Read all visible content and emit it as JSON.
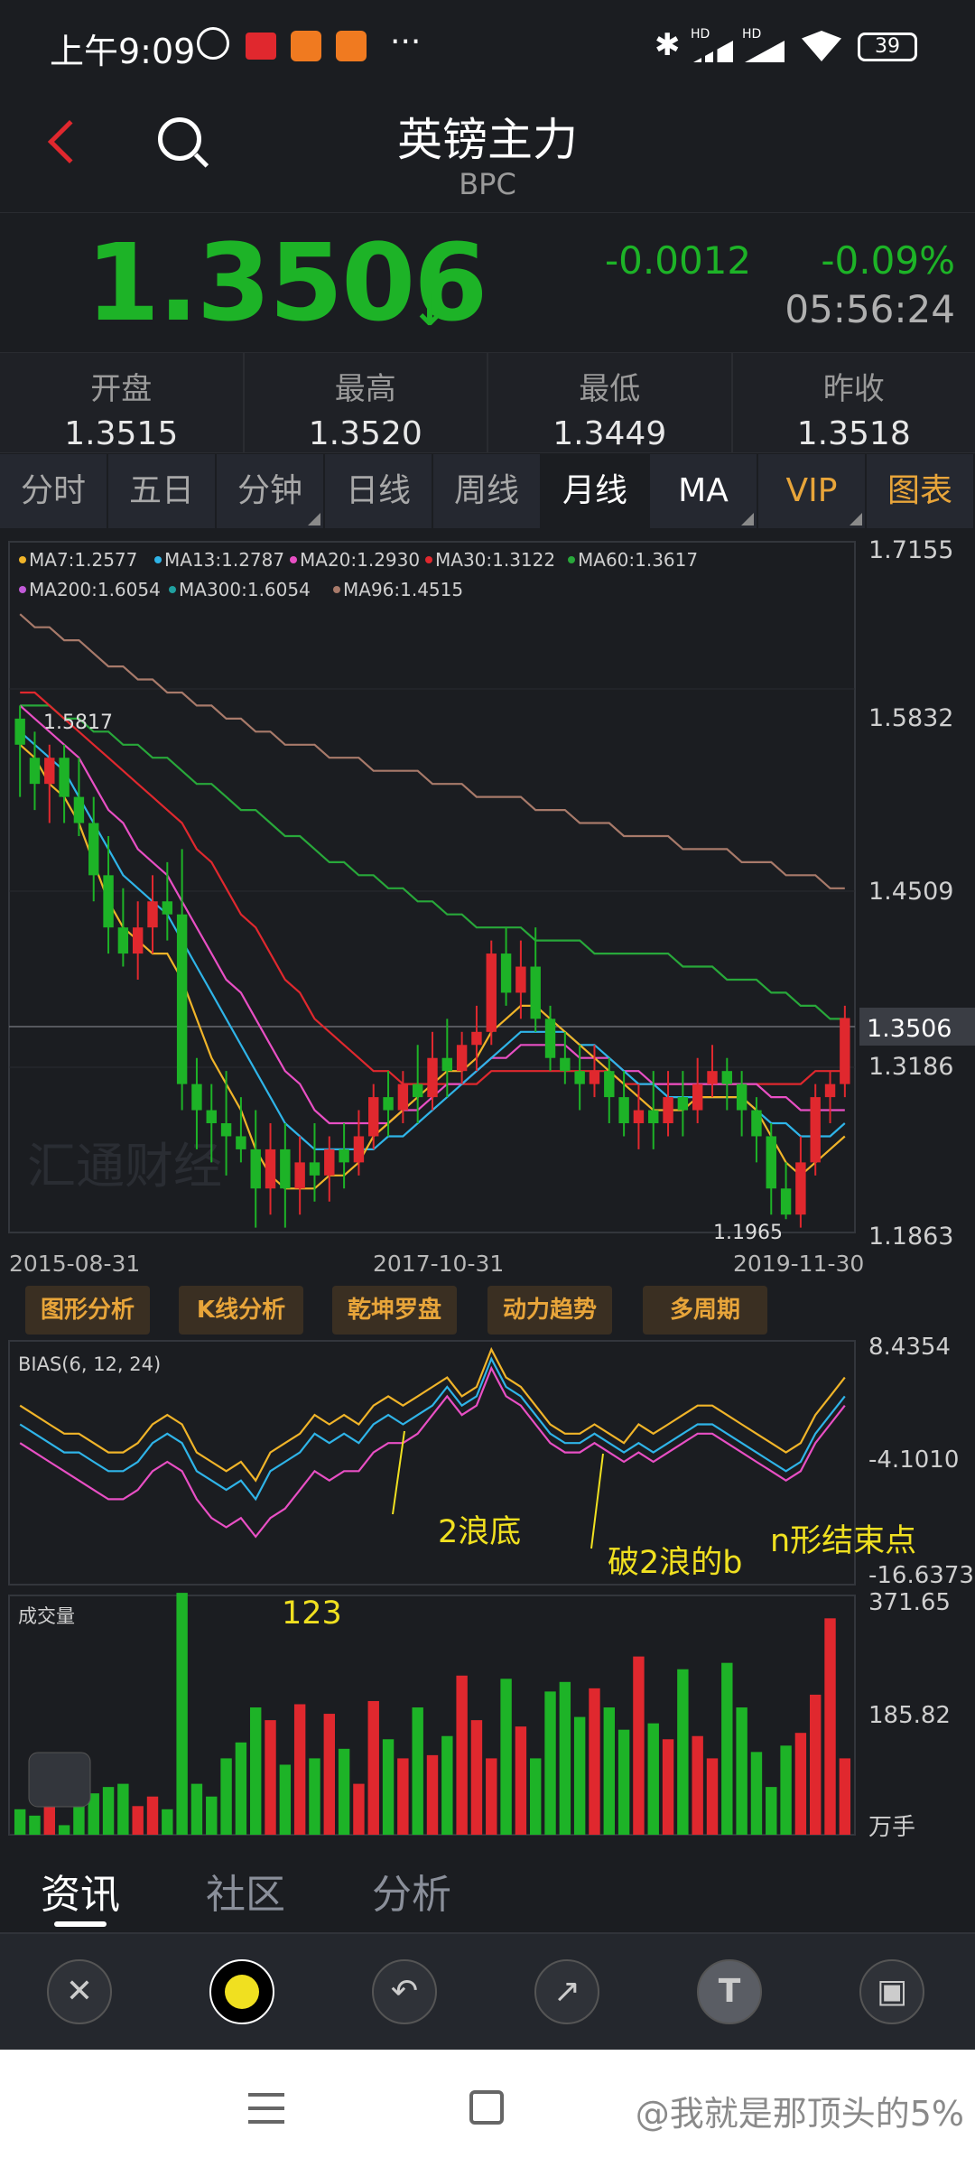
{
  "status": {
    "time": "上午9:09",
    "dots": "···",
    "battery": "39",
    "net1": "HD",
    "net2": "HD"
  },
  "header": {
    "title": "英镑主力",
    "code": "BPC"
  },
  "quote": {
    "price": "1.3506",
    "change": "-0.0012",
    "pct": "-0.09%",
    "time": "05:56:24",
    "colors": {
      "down": "#1db327",
      "up": "#e0282e"
    }
  },
  "ohlc": [
    {
      "label": "开盘",
      "value": "1.3515"
    },
    {
      "label": "最高",
      "value": "1.3520"
    },
    {
      "label": "最低",
      "value": "1.3449"
    },
    {
      "label": "昨收",
      "value": "1.3518"
    }
  ],
  "tabs": [
    "分时",
    "五日",
    "分钟",
    "日线",
    "周线",
    "月线",
    "MA",
    "VIP",
    "图表"
  ],
  "ma_legend": [
    {
      "text": "MA7:1.2577",
      "color": "#f0b429"
    },
    {
      "text": "MA13:1.2787",
      "color": "#2fb4e8"
    },
    {
      "text": "MA20:1.2930",
      "color": "#e84fc4"
    },
    {
      "text": "MA30:1.3122",
      "color": "#e0282e"
    },
    {
      "text": "MA60:1.3617",
      "color": "#28a83a"
    },
    {
      "text": "MA200:1.6054",
      "color": "#c15ad8"
    },
    {
      "text": "MA300:1.6054",
      "color": "#20a0a0"
    },
    {
      "text": "MA96:1.4515",
      "color": "#a87a6a"
    }
  ],
  "main_axis": [
    "1.7155",
    "1.5832",
    "1.4509",
    "1.3186",
    "1.1863"
  ],
  "current_price_tag": "1.3506",
  "high_label": "1.5817",
  "low_label": "1.1965",
  "dates": [
    "2015-08-31",
    "2017-10-31",
    "2019-11-30"
  ],
  "watermark": "汇通财经",
  "func_buttons": [
    "图形分析",
    "K线分析",
    "乾坤罗盘",
    "动力趋势",
    "多周期"
  ],
  "bias": {
    "label": "BIAS(6, 12, 24)",
    "axis": [
      "8.4354",
      "-4.1010",
      "-16.6373"
    ],
    "notes": [
      "2浪底",
      "破2浪的b",
      "n形结束点"
    ]
  },
  "volume": {
    "label": "成交量",
    "axis": [
      "371.65",
      "185.82",
      "万手"
    ],
    "note": "123"
  },
  "bottom_tabs": [
    "资讯",
    "社区",
    "分析"
  ],
  "tool_icons": [
    "close-icon",
    "color-dot-icon",
    "undo-icon",
    "arrow-icon",
    "text-icon",
    "save-icon"
  ],
  "tool_glyphs": {
    "t": "T"
  },
  "sysnav_watermark": "@我就是那顶头的5%",
  "chart_data": {
    "type": "candlestick",
    "ylim": [
      1.1863,
      1.7155
    ],
    "candles": [
      [
        1.58,
        1.56,
        1.59,
        1.52
      ],
      [
        1.55,
        1.53,
        1.57,
        1.51
      ],
      [
        1.53,
        1.55,
        1.56,
        1.5
      ],
      [
        1.55,
        1.52,
        1.56,
        1.5
      ],
      [
        1.52,
        1.5,
        1.55,
        1.49
      ],
      [
        1.5,
        1.46,
        1.52,
        1.44
      ],
      [
        1.46,
        1.42,
        1.49,
        1.4
      ],
      [
        1.42,
        1.4,
        1.45,
        1.39
      ],
      [
        1.4,
        1.42,
        1.44,
        1.38
      ],
      [
        1.42,
        1.44,
        1.46,
        1.4
      ],
      [
        1.44,
        1.43,
        1.47,
        1.41
      ],
      [
        1.43,
        1.3,
        1.48,
        1.28
      ],
      [
        1.3,
        1.28,
        1.32,
        1.25
      ],
      [
        1.28,
        1.27,
        1.3,
        1.24
      ],
      [
        1.27,
        1.26,
        1.31,
        1.23
      ],
      [
        1.26,
        1.25,
        1.29,
        1.24
      ],
      [
        1.25,
        1.22,
        1.28,
        1.19
      ],
      [
        1.22,
        1.25,
        1.27,
        1.2
      ],
      [
        1.25,
        1.22,
        1.27,
        1.19
      ],
      [
        1.22,
        1.24,
        1.26,
        1.2
      ],
      [
        1.24,
        1.23,
        1.27,
        1.21
      ],
      [
        1.23,
        1.25,
        1.26,
        1.21
      ],
      [
        1.25,
        1.24,
        1.27,
        1.22
      ],
      [
        1.24,
        1.26,
        1.28,
        1.23
      ],
      [
        1.26,
        1.29,
        1.3,
        1.25
      ],
      [
        1.29,
        1.28,
        1.31,
        1.26
      ],
      [
        1.28,
        1.3,
        1.31,
        1.27
      ],
      [
        1.3,
        1.29,
        1.33,
        1.27
      ],
      [
        1.29,
        1.32,
        1.34,
        1.28
      ],
      [
        1.32,
        1.31,
        1.35,
        1.29
      ],
      [
        1.31,
        1.33,
        1.34,
        1.3
      ],
      [
        1.33,
        1.34,
        1.36,
        1.31
      ],
      [
        1.34,
        1.4,
        1.41,
        1.33
      ],
      [
        1.4,
        1.37,
        1.42,
        1.36
      ],
      [
        1.37,
        1.39,
        1.41,
        1.35
      ],
      [
        1.39,
        1.35,
        1.42,
        1.34
      ],
      [
        1.35,
        1.32,
        1.36,
        1.31
      ],
      [
        1.32,
        1.31,
        1.34,
        1.3
      ],
      [
        1.31,
        1.3,
        1.33,
        1.28
      ],
      [
        1.3,
        1.31,
        1.33,
        1.29
      ],
      [
        1.31,
        1.29,
        1.32,
        1.27
      ],
      [
        1.29,
        1.27,
        1.31,
        1.26
      ],
      [
        1.27,
        1.28,
        1.3,
        1.25
      ],
      [
        1.28,
        1.27,
        1.31,
        1.25
      ],
      [
        1.27,
        1.29,
        1.31,
        1.26
      ],
      [
        1.29,
        1.28,
        1.31,
        1.26
      ],
      [
        1.28,
        1.3,
        1.32,
        1.27
      ],
      [
        1.3,
        1.31,
        1.33,
        1.29
      ],
      [
        1.31,
        1.3,
        1.32,
        1.28
      ],
      [
        1.3,
        1.28,
        1.31,
        1.26
      ],
      [
        1.28,
        1.26,
        1.29,
        1.24
      ],
      [
        1.26,
        1.22,
        1.27,
        1.2
      ],
      [
        1.22,
        1.2,
        1.24,
        1.1965
      ],
      [
        1.2,
        1.24,
        1.26,
        1.19
      ],
      [
        1.24,
        1.29,
        1.3,
        1.23
      ],
      [
        1.29,
        1.3,
        1.31,
        1.27
      ],
      [
        1.3,
        1.3506,
        1.36,
        1.29
      ]
    ],
    "volumes": [
      40,
      30,
      65,
      15,
      50,
      65,
      75,
      80,
      45,
      60,
      40,
      380,
      80,
      60,
      120,
      145,
      200,
      180,
      110,
      205,
      120,
      190,
      135,
      80,
      210,
      150,
      120,
      200,
      125,
      155,
      250,
      180,
      120,
      245,
      170,
      120,
      225,
      240,
      185,
      230,
      200,
      165,
      280,
      175,
      150,
      260,
      155,
      120,
      270,
      200,
      130,
      75,
      140,
      160,
      220,
      340,
      120
    ],
    "ma7": [
      1.56,
      1.55,
      1.53,
      1.52,
      1.5,
      1.47,
      1.44,
      1.42,
      1.41,
      1.4,
      1.4,
      1.38,
      1.35,
      1.32,
      1.3,
      1.28,
      1.25,
      1.23,
      1.22,
      1.22,
      1.22,
      1.23,
      1.23,
      1.24,
      1.26,
      1.27,
      1.28,
      1.29,
      1.3,
      1.31,
      1.31,
      1.32,
      1.34,
      1.35,
      1.36,
      1.36,
      1.35,
      1.34,
      1.33,
      1.32,
      1.31,
      1.3,
      1.29,
      1.28,
      1.28,
      1.28,
      1.29,
      1.29,
      1.29,
      1.29,
      1.28,
      1.26,
      1.24,
      1.23,
      1.24,
      1.25,
      1.26
    ],
    "ma13": [
      1.57,
      1.56,
      1.55,
      1.54,
      1.52,
      1.5,
      1.48,
      1.46,
      1.45,
      1.44,
      1.43,
      1.41,
      1.39,
      1.37,
      1.35,
      1.33,
      1.31,
      1.29,
      1.27,
      1.26,
      1.25,
      1.25,
      1.25,
      1.25,
      1.25,
      1.26,
      1.26,
      1.27,
      1.28,
      1.29,
      1.3,
      1.31,
      1.32,
      1.33,
      1.34,
      1.34,
      1.34,
      1.34,
      1.33,
      1.33,
      1.32,
      1.31,
      1.3,
      1.3,
      1.29,
      1.29,
      1.29,
      1.29,
      1.29,
      1.29,
      1.28,
      1.27,
      1.27,
      1.26,
      1.26,
      1.26,
      1.27
    ],
    "ma20": [
      1.59,
      1.58,
      1.57,
      1.56,
      1.55,
      1.53,
      1.51,
      1.5,
      1.48,
      1.47,
      1.46,
      1.44,
      1.42,
      1.4,
      1.38,
      1.37,
      1.35,
      1.33,
      1.31,
      1.3,
      1.28,
      1.27,
      1.27,
      1.27,
      1.27,
      1.27,
      1.28,
      1.28,
      1.29,
      1.3,
      1.3,
      1.31,
      1.32,
      1.32,
      1.33,
      1.33,
      1.33,
      1.33,
      1.32,
      1.32,
      1.32,
      1.31,
      1.31,
      1.3,
      1.3,
      1.3,
      1.3,
      1.3,
      1.3,
      1.3,
      1.3,
      1.29,
      1.29,
      1.28,
      1.28,
      1.28,
      1.28
    ],
    "ma30": [
      1.6,
      1.6,
      1.59,
      1.58,
      1.57,
      1.56,
      1.55,
      1.54,
      1.53,
      1.52,
      1.51,
      1.5,
      1.48,
      1.47,
      1.45,
      1.43,
      1.42,
      1.4,
      1.38,
      1.37,
      1.35,
      1.34,
      1.33,
      1.32,
      1.31,
      1.31,
      1.3,
      1.3,
      1.3,
      1.3,
      1.3,
      1.3,
      1.31,
      1.31,
      1.31,
      1.31,
      1.31,
      1.31,
      1.31,
      1.31,
      1.31,
      1.3,
      1.3,
      1.3,
      1.3,
      1.3,
      1.3,
      1.3,
      1.3,
      1.3,
      1.3,
      1.3,
      1.3,
      1.3,
      1.31,
      1.31,
      1.31
    ],
    "ma60": [
      1.59,
      1.59,
      1.59,
      1.58,
      1.58,
      1.57,
      1.57,
      1.56,
      1.56,
      1.55,
      1.55,
      1.54,
      1.53,
      1.53,
      1.52,
      1.51,
      1.51,
      1.5,
      1.49,
      1.49,
      1.48,
      1.47,
      1.47,
      1.46,
      1.46,
      1.45,
      1.45,
      1.44,
      1.44,
      1.43,
      1.43,
      1.42,
      1.42,
      1.42,
      1.42,
      1.41,
      1.41,
      1.41,
      1.41,
      1.4,
      1.4,
      1.4,
      1.4,
      1.4,
      1.4,
      1.39,
      1.39,
      1.39,
      1.38,
      1.38,
      1.38,
      1.37,
      1.37,
      1.36,
      1.36,
      1.35,
      1.35
    ],
    "ma96": [
      1.66,
      1.65,
      1.65,
      1.64,
      1.64,
      1.63,
      1.62,
      1.62,
      1.61,
      1.61,
      1.6,
      1.6,
      1.59,
      1.59,
      1.58,
      1.58,
      1.57,
      1.57,
      1.56,
      1.56,
      1.56,
      1.55,
      1.55,
      1.55,
      1.54,
      1.54,
      1.54,
      1.54,
      1.53,
      1.53,
      1.53,
      1.52,
      1.52,
      1.52,
      1.52,
      1.51,
      1.51,
      1.51,
      1.5,
      1.5,
      1.5,
      1.49,
      1.49,
      1.49,
      1.49,
      1.48,
      1.48,
      1.48,
      1.48,
      1.47,
      1.47,
      1.47,
      1.46,
      1.46,
      1.46,
      1.45,
      1.45
    ],
    "bias1": [
      2,
      1,
      0,
      -1,
      -1,
      -2,
      -3,
      -3,
      -2,
      0,
      1,
      0,
      -3,
      -4,
      -5,
      -4,
      -6,
      -3,
      -2,
      -1,
      1,
      0,
      1,
      0,
      2,
      3,
      2,
      3,
      4,
      5,
      3,
      4,
      8,
      5,
      4,
      2,
      0,
      -1,
      -1,
      0,
      -1,
      -2,
      0,
      -1,
      0,
      1,
      2,
      2,
      1,
      0,
      -1,
      -2,
      -3,
      -2,
      1,
      3,
      5
    ],
    "bias2": [
      0,
      -1,
      -2,
      -3,
      -3,
      -4,
      -5,
      -5,
      -4,
      -2,
      -1,
      -2,
      -5,
      -6,
      -7,
      -6,
      -8,
      -5,
      -4,
      -3,
      -1,
      -2,
      -1,
      -2,
      0,
      1,
      0,
      1,
      2,
      4,
      2,
      3,
      7,
      4,
      3,
      1,
      -1,
      -2,
      -2,
      -1,
      -2,
      -3,
      -2,
      -3,
      -2,
      -1,
      0,
      0,
      -1,
      -2,
      -3,
      -4,
      -5,
      -4,
      -1,
      1,
      3
    ],
    "bias3": [
      -2,
      -3,
      -4,
      -5,
      -6,
      -7,
      -8,
      -8,
      -7,
      -5,
      -4,
      -5,
      -8,
      -10,
      -11,
      -10,
      -12,
      -10,
      -9,
      -7,
      -5,
      -6,
      -5,
      -5,
      -3,
      -2,
      -2,
      -1,
      1,
      3,
      1,
      2,
      6,
      3,
      2,
      0,
      -2,
      -3,
      -3,
      -2,
      -3,
      -4,
      -3,
      -4,
      -3,
      -2,
      -1,
      -1,
      -2,
      -3,
      -4,
      -5,
      -6,
      -5,
      -2,
      0,
      2
    ],
    "bias_ylim": [
      -16.6373,
      8.4354
    ],
    "vol_ylim": [
      0,
      371.65
    ]
  }
}
